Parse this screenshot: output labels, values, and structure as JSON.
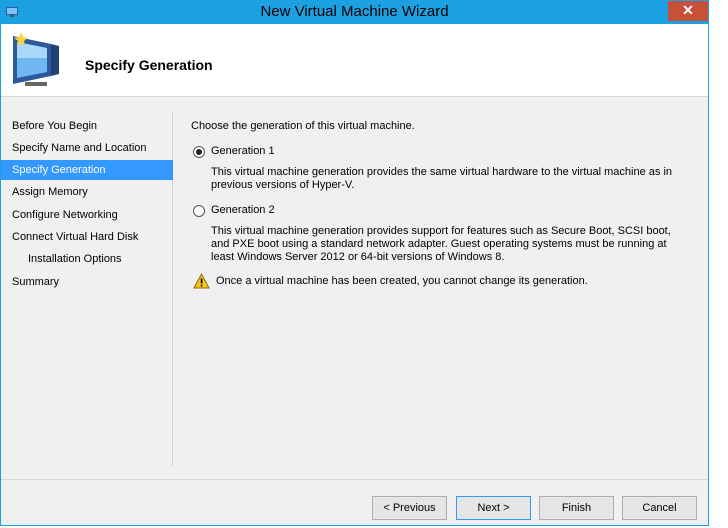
{
  "window": {
    "title": "New Virtual Machine Wizard",
    "close_glyph": "✕"
  },
  "header": {
    "title": "Specify Generation",
    "icon": "new-vm-icon"
  },
  "nav": {
    "items": [
      {
        "label": "Before You Begin"
      },
      {
        "label": "Specify Name and Location"
      },
      {
        "label": "Specify Generation"
      },
      {
        "label": "Assign Memory"
      },
      {
        "label": "Configure Networking"
      },
      {
        "label": "Connect Virtual Hard Disk"
      },
      {
        "label": "Installation Options"
      },
      {
        "label": "Summary"
      }
    ],
    "active_index": 2
  },
  "main": {
    "intro": "Choose the generation of this virtual machine.",
    "options": [
      {
        "label": "Generation 1",
        "checked": true,
        "description": "This virtual machine generation provides the same virtual hardware to the virtual machine as in previous versions of Hyper-V."
      },
      {
        "label": "Generation 2",
        "checked": false,
        "description": "This virtual machine generation provides support for features such as Secure Boot, SCSI boot, and PXE boot using a standard network adapter. Guest operating systems must be running at least Windows Server 2012 or 64-bit versions of Windows 8."
      }
    ],
    "warning": "Once a virtual machine has been created, you cannot change its generation."
  },
  "buttons": {
    "previous": "< Previous",
    "next": "Next >",
    "finish": "Finish",
    "cancel": "Cancel"
  },
  "colors": {
    "titlebar": "#1ba1e2",
    "selection": "#3399ff",
    "close": "#c7503b"
  }
}
